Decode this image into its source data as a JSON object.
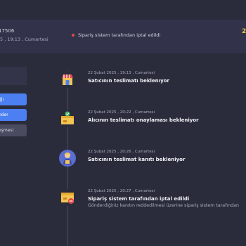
{
  "header": {
    "order_id": "17506",
    "order_date": "5 , 19:13 , Cumartesi",
    "cancel_note": "Sipariş sistem tarafından iptal edildi",
    "corner_value": "2"
  },
  "sidebar": {
    "buttons": [
      {
        "label": "ığı"
      },
      {
        "label": "nder"
      },
      {
        "label": "eşmesi"
      }
    ]
  },
  "timeline": [
    {
      "date": "22 Şubat 2025 , 19:13 , Cumartesi",
      "title": "Satıcının teslimatı beklenıyor",
      "icon": "store-icon"
    },
    {
      "date": "22 Şubat 2025 , 20:22 , Cumartesi",
      "title": "Alıcının teslimatı onaylaması bekleniyor",
      "icon": "box-check-icon"
    },
    {
      "date": "22 Şubat 2025 , 20:26 , Cumartesi",
      "title": "Satıcının teslimat kanıtı bekleniyor",
      "icon": "courier-icon"
    },
    {
      "date": "22 Şubat 2025 , 20:27 , Cumartesi",
      "title": "Sipariş sistem tarafından iptal edildi",
      "desc": "Gönderdiğiniz kanıtın reddedilmesi üzerine sipariş sistem tarafından",
      "icon": "box-cancel-icon"
    }
  ],
  "colors": {
    "accent": "#4c7ff2",
    "cancel": "#e24b4b",
    "background": "#2b2c3b"
  }
}
